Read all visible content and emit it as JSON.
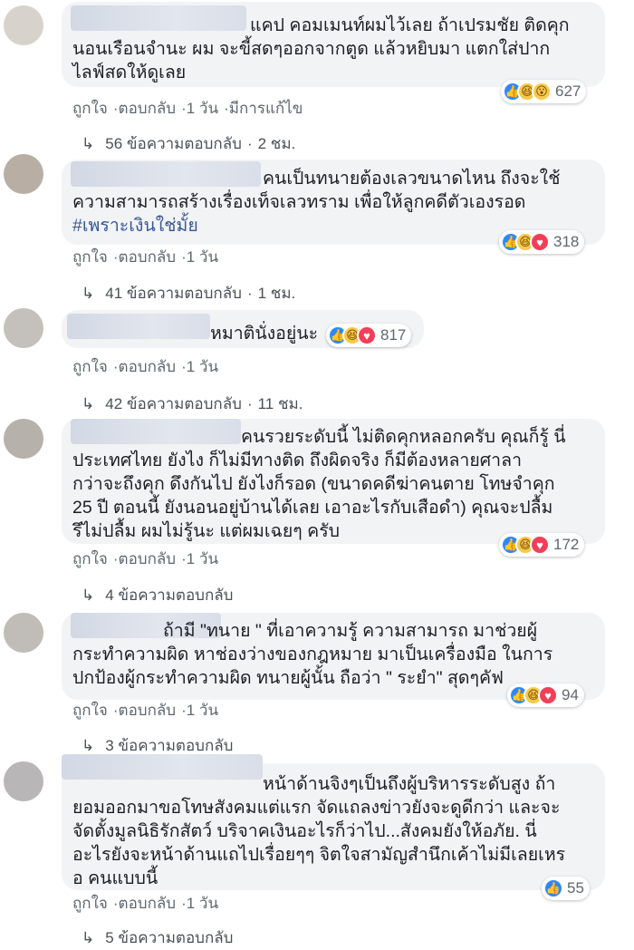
{
  "comments": [
    {
      "text": "แคป คอมเมนท์ผมไว้เลย ถ้าเปรมชัย ติดคุก\nนอนเรือนจำนะ ผม จะขี้สดๆออกจากตูด แล้วหยิบมา แตกใส่ปาก\nไลฟ์สดให้ดูเลย",
      "hashtag": "",
      "reactions": [
        "like",
        "haha",
        "wow"
      ],
      "reaction_count": "627",
      "like": "ถูกใจ",
      "reply": "ตอบกลับ",
      "time": "1 วัน",
      "edited": "มีการแก้ไข",
      "replies_text": "56 ข้อความตอบกลับ",
      "replies_time": "2 ชม."
    },
    {
      "text": "คนเป็นทนายต้องเลวขนาดไหน ถึงจะใช้\nความสามารถสร้างเรื่องเท็จเลวทราม เพื่อให้ลูกคดีตัวเองรอด",
      "hashtag": "#เพราะเงินใช่มั้ย",
      "reactions": [
        "like",
        "haha",
        "love"
      ],
      "reaction_count": "318",
      "like": "ถูกใจ",
      "reply": "ตอบกลับ",
      "time": "1 วัน",
      "edited": "",
      "replies_text": "41 ข้อความตอบกลับ",
      "replies_time": "1 ชม."
    },
    {
      "text": "หมาตินั่งอยู่นะ",
      "hashtag": "",
      "reactions": [
        "like",
        "haha",
        "love"
      ],
      "reaction_count": "817",
      "like": "ถูกใจ",
      "reply": "ตอบกลับ",
      "time": "1 วัน",
      "edited": "",
      "replies_text": "42 ข้อความตอบกลับ",
      "replies_time": "11 ชม."
    },
    {
      "text": "คนรวยระดับนี้ ไม่ติดคุกหลอกครับ คุณก็รู้ นี่\nประเทศไทย ยังไง ก็ไม่มีทางติด ถึงผิดจริง ก็มีต้องหลายศาลา\nกว่าจะถึงคุก ดึงกันไป ยังไงก็รอด (ขนาดคดีฆ่าคนตาย โทษจำคุก\n25 ปี ตอนนี้ ยังนอนอยู่บ้านได้เลย เอาอะไรกับเสือดำ) คุณจะปลื้ม\nรึไม่ปลื้ม ผมไม่รู้นะ แต่ผมเฉยๆ ครับ",
      "hashtag": "",
      "reactions": [
        "like",
        "haha",
        "love"
      ],
      "reaction_count": "172",
      "like": "ถูกใจ",
      "reply": "ตอบกลับ",
      "time": "1 วัน",
      "edited": "",
      "replies_text": "4 ข้อความตอบกลับ",
      "replies_time": ""
    },
    {
      "text": "ถ้ามี \"ทนาย \" ที่เอาความรู้ ความสามารถ มาช่วยผู้\nกระทำความผิด หาช่องว่างของกฎหมาย มาเป็นเครื่องมือ ในการ\nปกป้องผู้กระทำความผิด ทนายผู้นั้น ถือว่า \" ระยำ\" สุดๆคัฟ",
      "hashtag": "",
      "reactions": [
        "like",
        "haha",
        "love"
      ],
      "reaction_count": "94",
      "like": "ถูกใจ",
      "reply": "ตอบกลับ",
      "time": "1 วัน",
      "edited": "",
      "replies_text": "3 ข้อความตอบกลับ",
      "replies_time": ""
    },
    {
      "text": "หน้าด้านจิงๆเป็นถึงผู้บริหารระดับสูง ถ้า\nยอมออกมาขอโทษสังคมแต่แรก จัดแถลงข่าวยังจะดูดีกว่า และจะ\nจัดตั้งมูลนิธิรักสัตว์ บริจาคเงินอะไรก็ว่าไป...สังคมยังให้อภัย. นี่\nอะไรยังจะหน้าด้านแถไปเรื่อยๆๆ จิตใจสามัญสำนึกเค้าไม่มีเลยเหร\nอ คนแบบนี้",
      "hashtag": "",
      "reactions": [
        "like"
      ],
      "reaction_count": "55",
      "like": "ถูกใจ",
      "reply": "ตอบกลับ",
      "time": "1 วัน",
      "edited": "",
      "replies_text": "5 ข้อความตอบกลับ",
      "replies_time": ""
    }
  ],
  "separator": "·",
  "reply_arrow": "↳",
  "reaction_icons": {
    "like": "👍",
    "haha": "😆",
    "wow": "😮",
    "love": "♥"
  }
}
